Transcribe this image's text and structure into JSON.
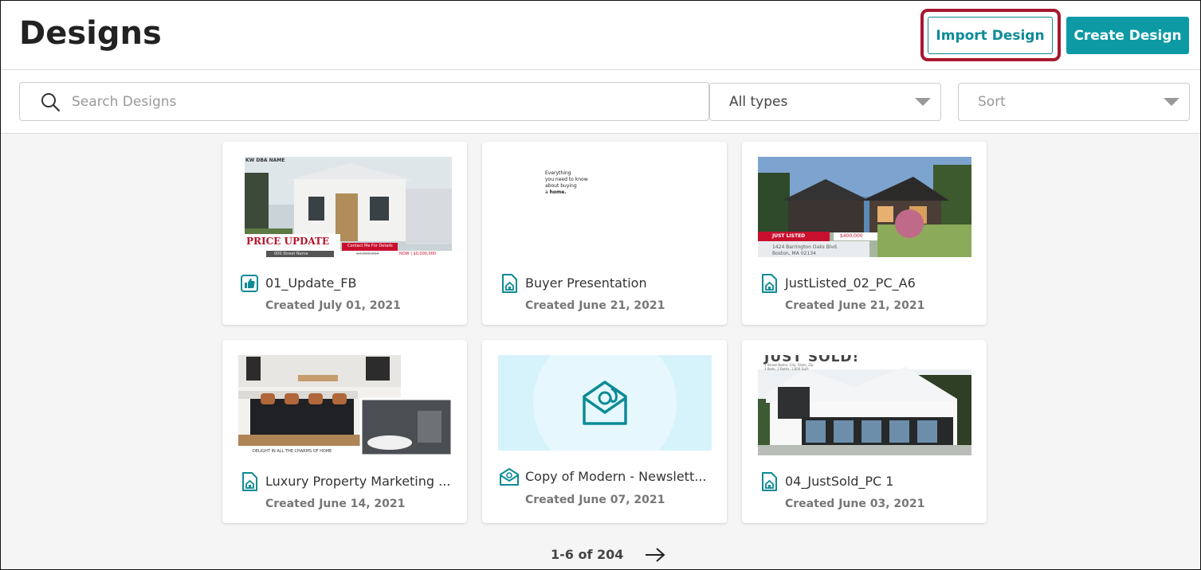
{
  "page": {
    "title": "Designs"
  },
  "header": {
    "import_label": "Import Design",
    "create_label": "Create Design"
  },
  "filters": {
    "search_placeholder": "Search Designs",
    "type_value": "All types",
    "sort_value": "Sort"
  },
  "thumbs": {
    "t1": {
      "brand": "KW DBA NAME",
      "banner": "PRICE UPDATE",
      "contact": "Contact Me For Details",
      "street": "000 Street Name",
      "old_price": "$0,000,000",
      "new_price": "NOW | $0,000,000"
    },
    "t2": {
      "line1": "Everything",
      "line2": "you need to know",
      "line3": "about buying",
      "line4_pre": "a ",
      "line4_bold": "home."
    },
    "t3": {
      "badge": "JUST LISTED",
      "price": "$400,000",
      "address1": "1424 Barrington Oaks Blvd.",
      "address2": "Boston, MA 02134"
    },
    "t4": {
      "caption": "DELIGHT IN ALL THE CHARMS OF HOME"
    },
    "t6": {
      "headline": "JUST SOLD!",
      "sub1": "1 Street Name, City, State, Zip",
      "sub2": "3 Beds, 2 Baths, 1,600 SqFt"
    }
  },
  "designs": [
    {
      "name": "01_Update_FB",
      "date": "Created July 01, 2021",
      "icon": "thumbs-up-icon"
    },
    {
      "name": "Buyer Presentation",
      "date": "Created June 21, 2021",
      "icon": "document-house-icon"
    },
    {
      "name": "JustListed_02_PC_A6",
      "date": "Created June 21, 2021",
      "icon": "document-house-icon"
    },
    {
      "name": "Luxury Property Marketing ...",
      "date": "Created June 14, 2021",
      "icon": "document-house-icon"
    },
    {
      "name": "Copy of Modern - Newslett...",
      "date": "Created June 07, 2021",
      "icon": "email-icon"
    },
    {
      "name": "04_JustSold_PC 1",
      "date": "Created June 03, 2021",
      "icon": "document-house-icon"
    }
  ],
  "pagination": {
    "label": "1-6 of 204"
  },
  "colors": {
    "accent": "#0d9aa5",
    "highlight": "#a6192e"
  }
}
